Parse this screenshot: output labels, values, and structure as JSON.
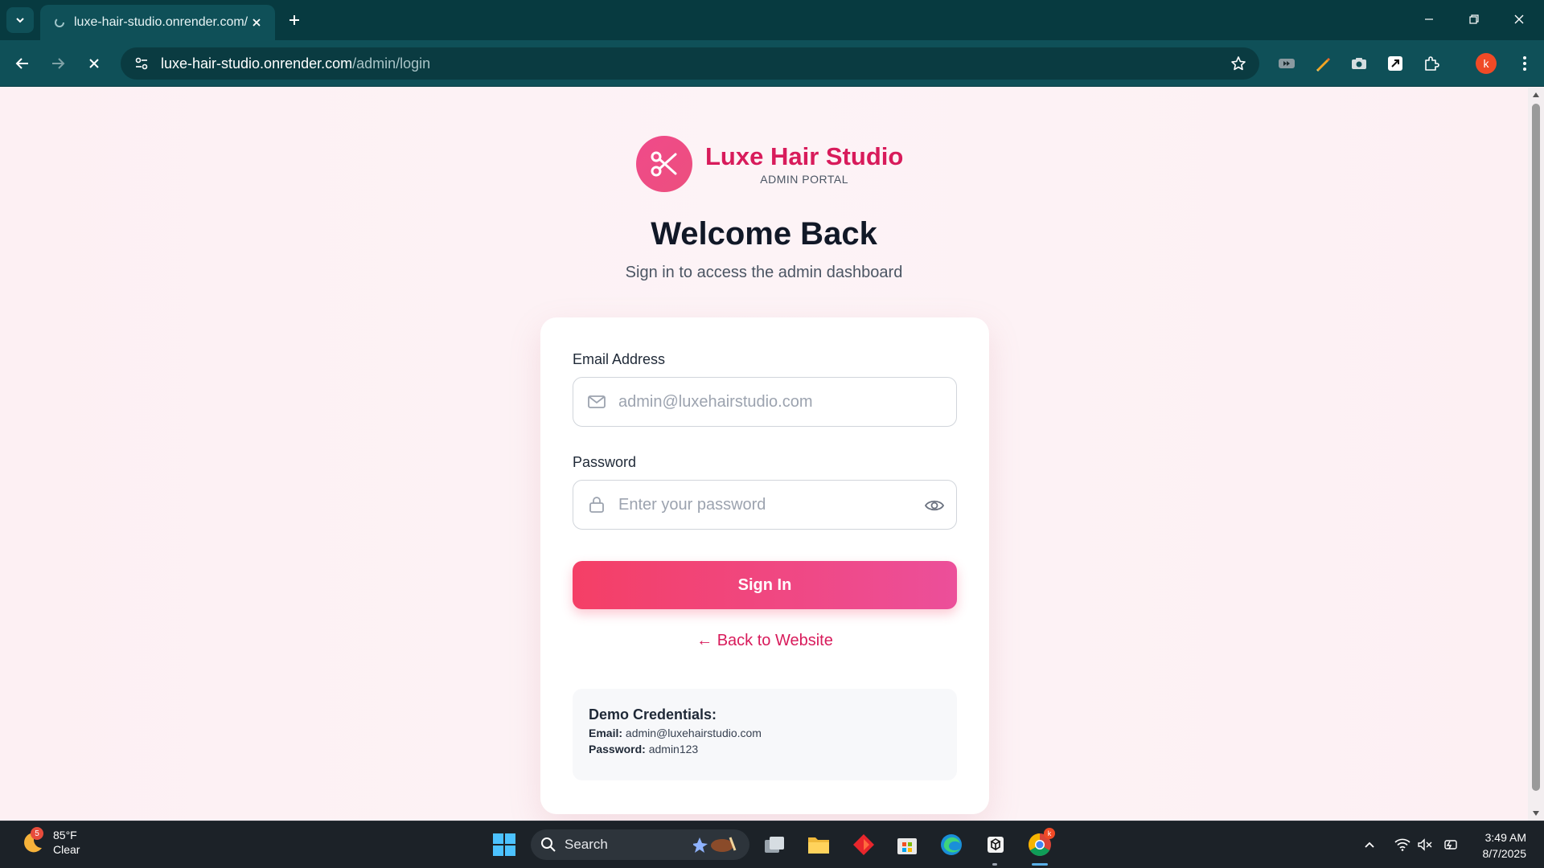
{
  "browser": {
    "tab_title": "luxe-hair-studio.onrender.com/",
    "url_host": "luxe-hair-studio.onrender.com",
    "url_path": "/admin/login",
    "profile_initial": "k"
  },
  "brand": {
    "name": "Luxe Hair Studio",
    "subtitle": "ADMIN PORTAL"
  },
  "login": {
    "title": "Welcome Back",
    "subtitle": "Sign in to access the admin dashboard",
    "email_label": "Email Address",
    "email_placeholder": "admin@luxehairstudio.com",
    "password_label": "Password",
    "password_placeholder": "Enter your password",
    "sign_in_label": "Sign In",
    "back_link": "← Back to Website"
  },
  "demo": {
    "title": "Demo Credentials:",
    "email_key": "Email:",
    "email_value": "admin@luxehairstudio.com",
    "password_key": "Password:",
    "password_value": "admin123"
  },
  "taskbar": {
    "weather_temp": "85°F",
    "weather_cond": "Clear",
    "weather_badge": "5",
    "search_label": "Search",
    "time": "3:49 AM",
    "date": "8/7/2025",
    "chrome_badge": "k"
  },
  "colors": {
    "brand_pink": "#d81b5b",
    "button_start": "#f43f66",
    "button_end": "#ec4f9a",
    "chrome_teal": "#0f5058"
  }
}
